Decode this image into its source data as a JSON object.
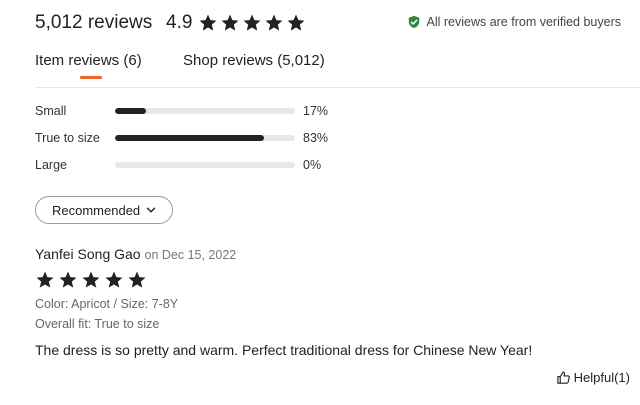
{
  "header": {
    "review_count": "5,012 reviews",
    "rating": "4.9",
    "rating_stars": 5,
    "verified_text": "All reviews are from verified buyers"
  },
  "tabs": [
    {
      "label": "Item reviews (6)",
      "active": true
    },
    {
      "label": "Shop reviews (5,012)",
      "active": false
    }
  ],
  "fit": [
    {
      "label": "Small",
      "percent_text": "17%",
      "value": 0.17
    },
    {
      "label": "True to size",
      "percent_text": "83%",
      "value": 0.83
    },
    {
      "label": "Large",
      "percent_text": "0%",
      "value": 0.0
    }
  ],
  "sort": {
    "label": "Recommended"
  },
  "review": {
    "reviewer": "Yanfei Song Gao",
    "date_text": "on Dec 15, 2022",
    "stars": 5,
    "variation": "Color: Apricot / Size: 7-8Y",
    "overall_fit": "Overall fit: True to size",
    "text": "The dress is so pretty and warm. Perfect traditional dress for Chinese New Year!",
    "helpful_label": "Helpful(1)"
  },
  "colors": {
    "accent": "#f1641e",
    "verified_green": "#2e8540",
    "star": "#222222"
  }
}
